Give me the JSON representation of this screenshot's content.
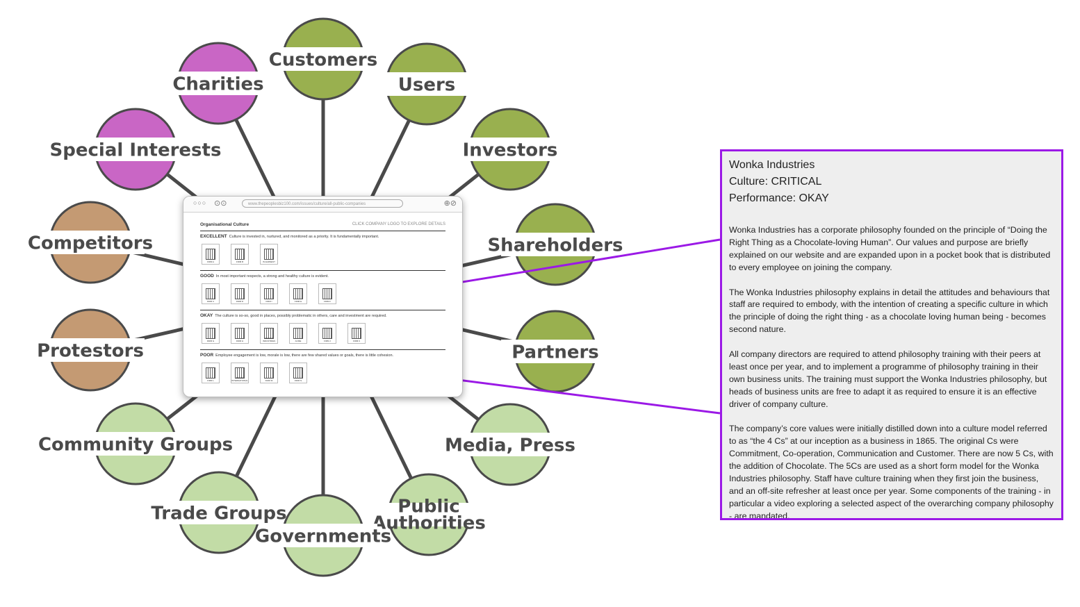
{
  "stakeholders": [
    {
      "label": "Customers",
      "color": "#99b04f"
    },
    {
      "label": "Users",
      "color": "#99b04f"
    },
    {
      "label": "Investors",
      "color": "#99b04f"
    },
    {
      "label": "Shareholders",
      "color": "#99b04f"
    },
    {
      "label": "Partners",
      "color": "#99b04f"
    },
    {
      "label": "Media, Press",
      "color": "#c2dca6"
    },
    {
      "label": "Public",
      "color": "#c2dca6"
    },
    {
      "label": "Governments",
      "color": "#c2dca6"
    },
    {
      "label": "Trade Groups",
      "color": "#c2dca6"
    },
    {
      "label": "Community Groups",
      "color": "#c2dca6"
    },
    {
      "label": "Protestors",
      "color": "#c49a73"
    },
    {
      "label": "Competitors",
      "color": "#c49a73"
    },
    {
      "label": "Special Interests",
      "color": "#c966c5"
    },
    {
      "label": "Charities",
      "color": "#c966c5"
    }
  ],
  "stakeholder_label_extra": {
    "public_line2": "Authorities"
  },
  "browser": {
    "url": "www.thepeoplesbiz100.com/issues/culture/all-public-companies",
    "title": "Organisational Culture",
    "cta": "CLICK COMPANY LOGO TO EXPLORE DETAILS",
    "categories": [
      {
        "level": "EXCELLENT",
        "desc": "Culture is invested in, nurtured, and monitored as a priority. It is fundamentally important.",
        "logos": [
          "FIRM A",
          "FIRM B",
          "IN EARNEST"
        ]
      },
      {
        "level": "GOOD",
        "desc": "In most important respects, a strong and healthy culture is evident.",
        "logos": [
          "FIRM C",
          "FIRM D",
          "FIRM I",
          "FIRM E",
          "FIRM F"
        ]
      },
      {
        "level": "OKAY",
        "desc": "The culture is so-so, good in places, possibly problematic in others, care and investment are required.",
        "logos": [
          "FIRM G",
          "FIRM H",
          "WONKA INDUSTRIES",
          "ACME",
          "FIRM J",
          "FIRM K"
        ]
      },
      {
        "level": "POOR",
        "desc": "Employee engagement is low, morale is low, there are few shared values or goals, there is little cohesion.",
        "logos": [
          "FIRM L",
          "BRAND INTERNATIONAL",
          "FIRM M",
          "FIRM N"
        ]
      }
    ]
  },
  "highlight_color": "#9b19e6",
  "panel": {
    "company": "Wonka Industries",
    "culture": "Culture: CRITICAL",
    "performance": "Performance: OKAY",
    "paragraphs": [
      "Wonka Industries has a corporate philosophy founded on the principle of “Doing the Right Thing as a Chocolate-loving Human”. Our values and purpose are briefly explained on our website and are expanded upon in a pocket book that is distributed to every employee on joining the company.",
      "The Wonka Industries philosophy explains in detail the attitudes and behaviours that staff are required to embody, with the intention of creating a specific culture in which the principle of doing the right thing - as a chocolate loving human being - becomes second nature.",
      "All company directors are required to attend philosophy training with their peers at least once per year, and to implement a programme of philosophy training in their own business units. The training must support the Wonka Industries philosophy, but heads of business units are free to adapt it as required to ensure it is an effective driver of company culture.",
      "The company’s core values were initially distilled down into a culture model referred to as “the 4 Cs” at our inception as a business in 1865. The original Cs were Commitment, Co-operation, Communication and Customer. There are now 5 Cs, with the addition of Chocolate. The 5Cs are used as a short form model for the  Wonka Industries philosophy. Staff have culture training when they first join the business, and an off-site refresher at least once per year. Some components of the training - in particular a video exploring a selected aspect of the overarching company philosophy - are mandated."
    ]
  }
}
